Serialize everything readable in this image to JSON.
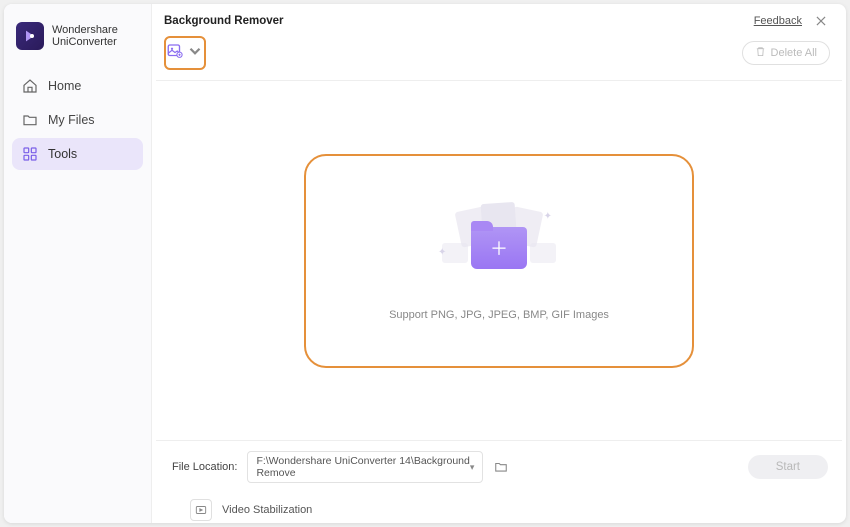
{
  "app": {
    "name_line1": "Wondershare",
    "name_line2": "UniConverter"
  },
  "sidebar": {
    "items": [
      {
        "label": "Home",
        "icon": "home-icon"
      },
      {
        "label": "My Files",
        "icon": "files-icon"
      },
      {
        "label": "Tools",
        "icon": "tools-icon"
      }
    ]
  },
  "modal": {
    "title": "Background Remover",
    "feedback": "Feedback",
    "delete_all": "Delete All",
    "support_text": "Support PNG, JPG, JPEG, BMP, GIF Images",
    "file_location_label": "File Location:",
    "file_location_path": "F:\\Wondershare UniConverter 14\\Background Remove",
    "start_label": "Start"
  },
  "below": {
    "label": "Video Stabilization"
  },
  "colors": {
    "accent_orange": "#e5903a",
    "accent_purple": "#9a76f3",
    "sidebar_active": "#eae5fa"
  }
}
